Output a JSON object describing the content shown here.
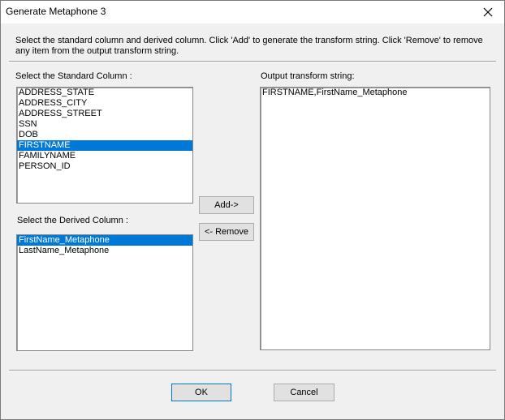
{
  "window": {
    "title": "Generate Metaphone 3"
  },
  "instructions": "Select the standard column and derived column. Click 'Add' to generate the transform string. Click 'Remove' to remove any item from the output transform string.",
  "standard_column": {
    "label": "Select the Standard Column :",
    "items": [
      "ADDRESS_STATE",
      "ADDRESS_CITY",
      "ADDRESS_STREET",
      "SSN",
      "DOB",
      "FIRSTNAME",
      "FAMILYNAME",
      "PERSON_ID"
    ],
    "selected": "FIRSTNAME"
  },
  "derived_column": {
    "label": "Select the Derived Column :",
    "items": [
      "FirstName_Metaphone",
      "LastName_Metaphone"
    ],
    "selected": "FirstName_Metaphone"
  },
  "output": {
    "label": "Output transform string:",
    "items": [
      "FIRSTNAME,FirstName_Metaphone"
    ]
  },
  "buttons": {
    "add": "Add->",
    "remove": "<- Remove",
    "ok": "OK",
    "cancel": "Cancel"
  },
  "colors": {
    "selection": "#0078d7",
    "dialog_bg": "#f0f0f0"
  }
}
